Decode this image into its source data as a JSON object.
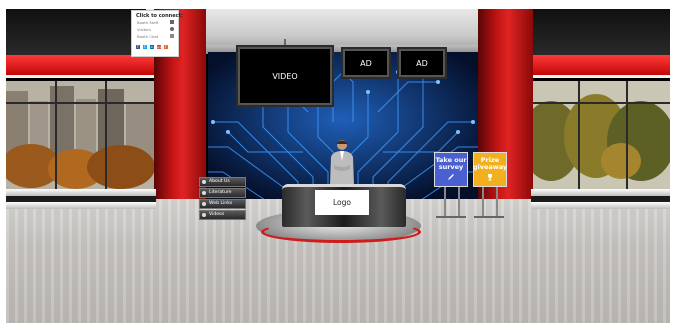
{
  "connect_panel": {
    "title": "Click to connect:",
    "items": [
      {
        "label": "Booth Staff",
        "icon": "chat-icon"
      },
      {
        "label": "Visitors",
        "icon": "people-icon"
      },
      {
        "label": "Booth Chat",
        "icon": "message-icon"
      }
    ],
    "socials": [
      {
        "icon": "facebook-icon",
        "glyph": "f",
        "color": "#3b5998"
      },
      {
        "icon": "twitter-icon",
        "glyph": "t",
        "color": "#1da1f2"
      },
      {
        "icon": "linkedin-icon",
        "glyph": "in",
        "color": "#0077b5"
      },
      {
        "icon": "google-plus-icon",
        "glyph": "g+",
        "color": "#dd4b39"
      },
      {
        "icon": "rss-icon",
        "glyph": "r",
        "color": "#f26522"
      }
    ]
  },
  "screens": {
    "video_label": "VIDEO",
    "ad_left_label": "AD",
    "ad_right_label": "AD"
  },
  "menu": {
    "items": [
      "About Us",
      "Literature",
      "Web Links",
      "Videos"
    ]
  },
  "desk": {
    "logo_label": "Logo"
  },
  "signs": {
    "survey": {
      "line1": "Take our",
      "line2": "survey",
      "color": "#4a5fd0",
      "icon": "pencil-icon"
    },
    "prize": {
      "line1": "Prize",
      "line2": "giveaway",
      "color": "#f2b01e",
      "icon": "trophy-icon"
    }
  },
  "colors": {
    "brand_red": "#d11a1a",
    "circuit_blue": "#2f8cff"
  }
}
